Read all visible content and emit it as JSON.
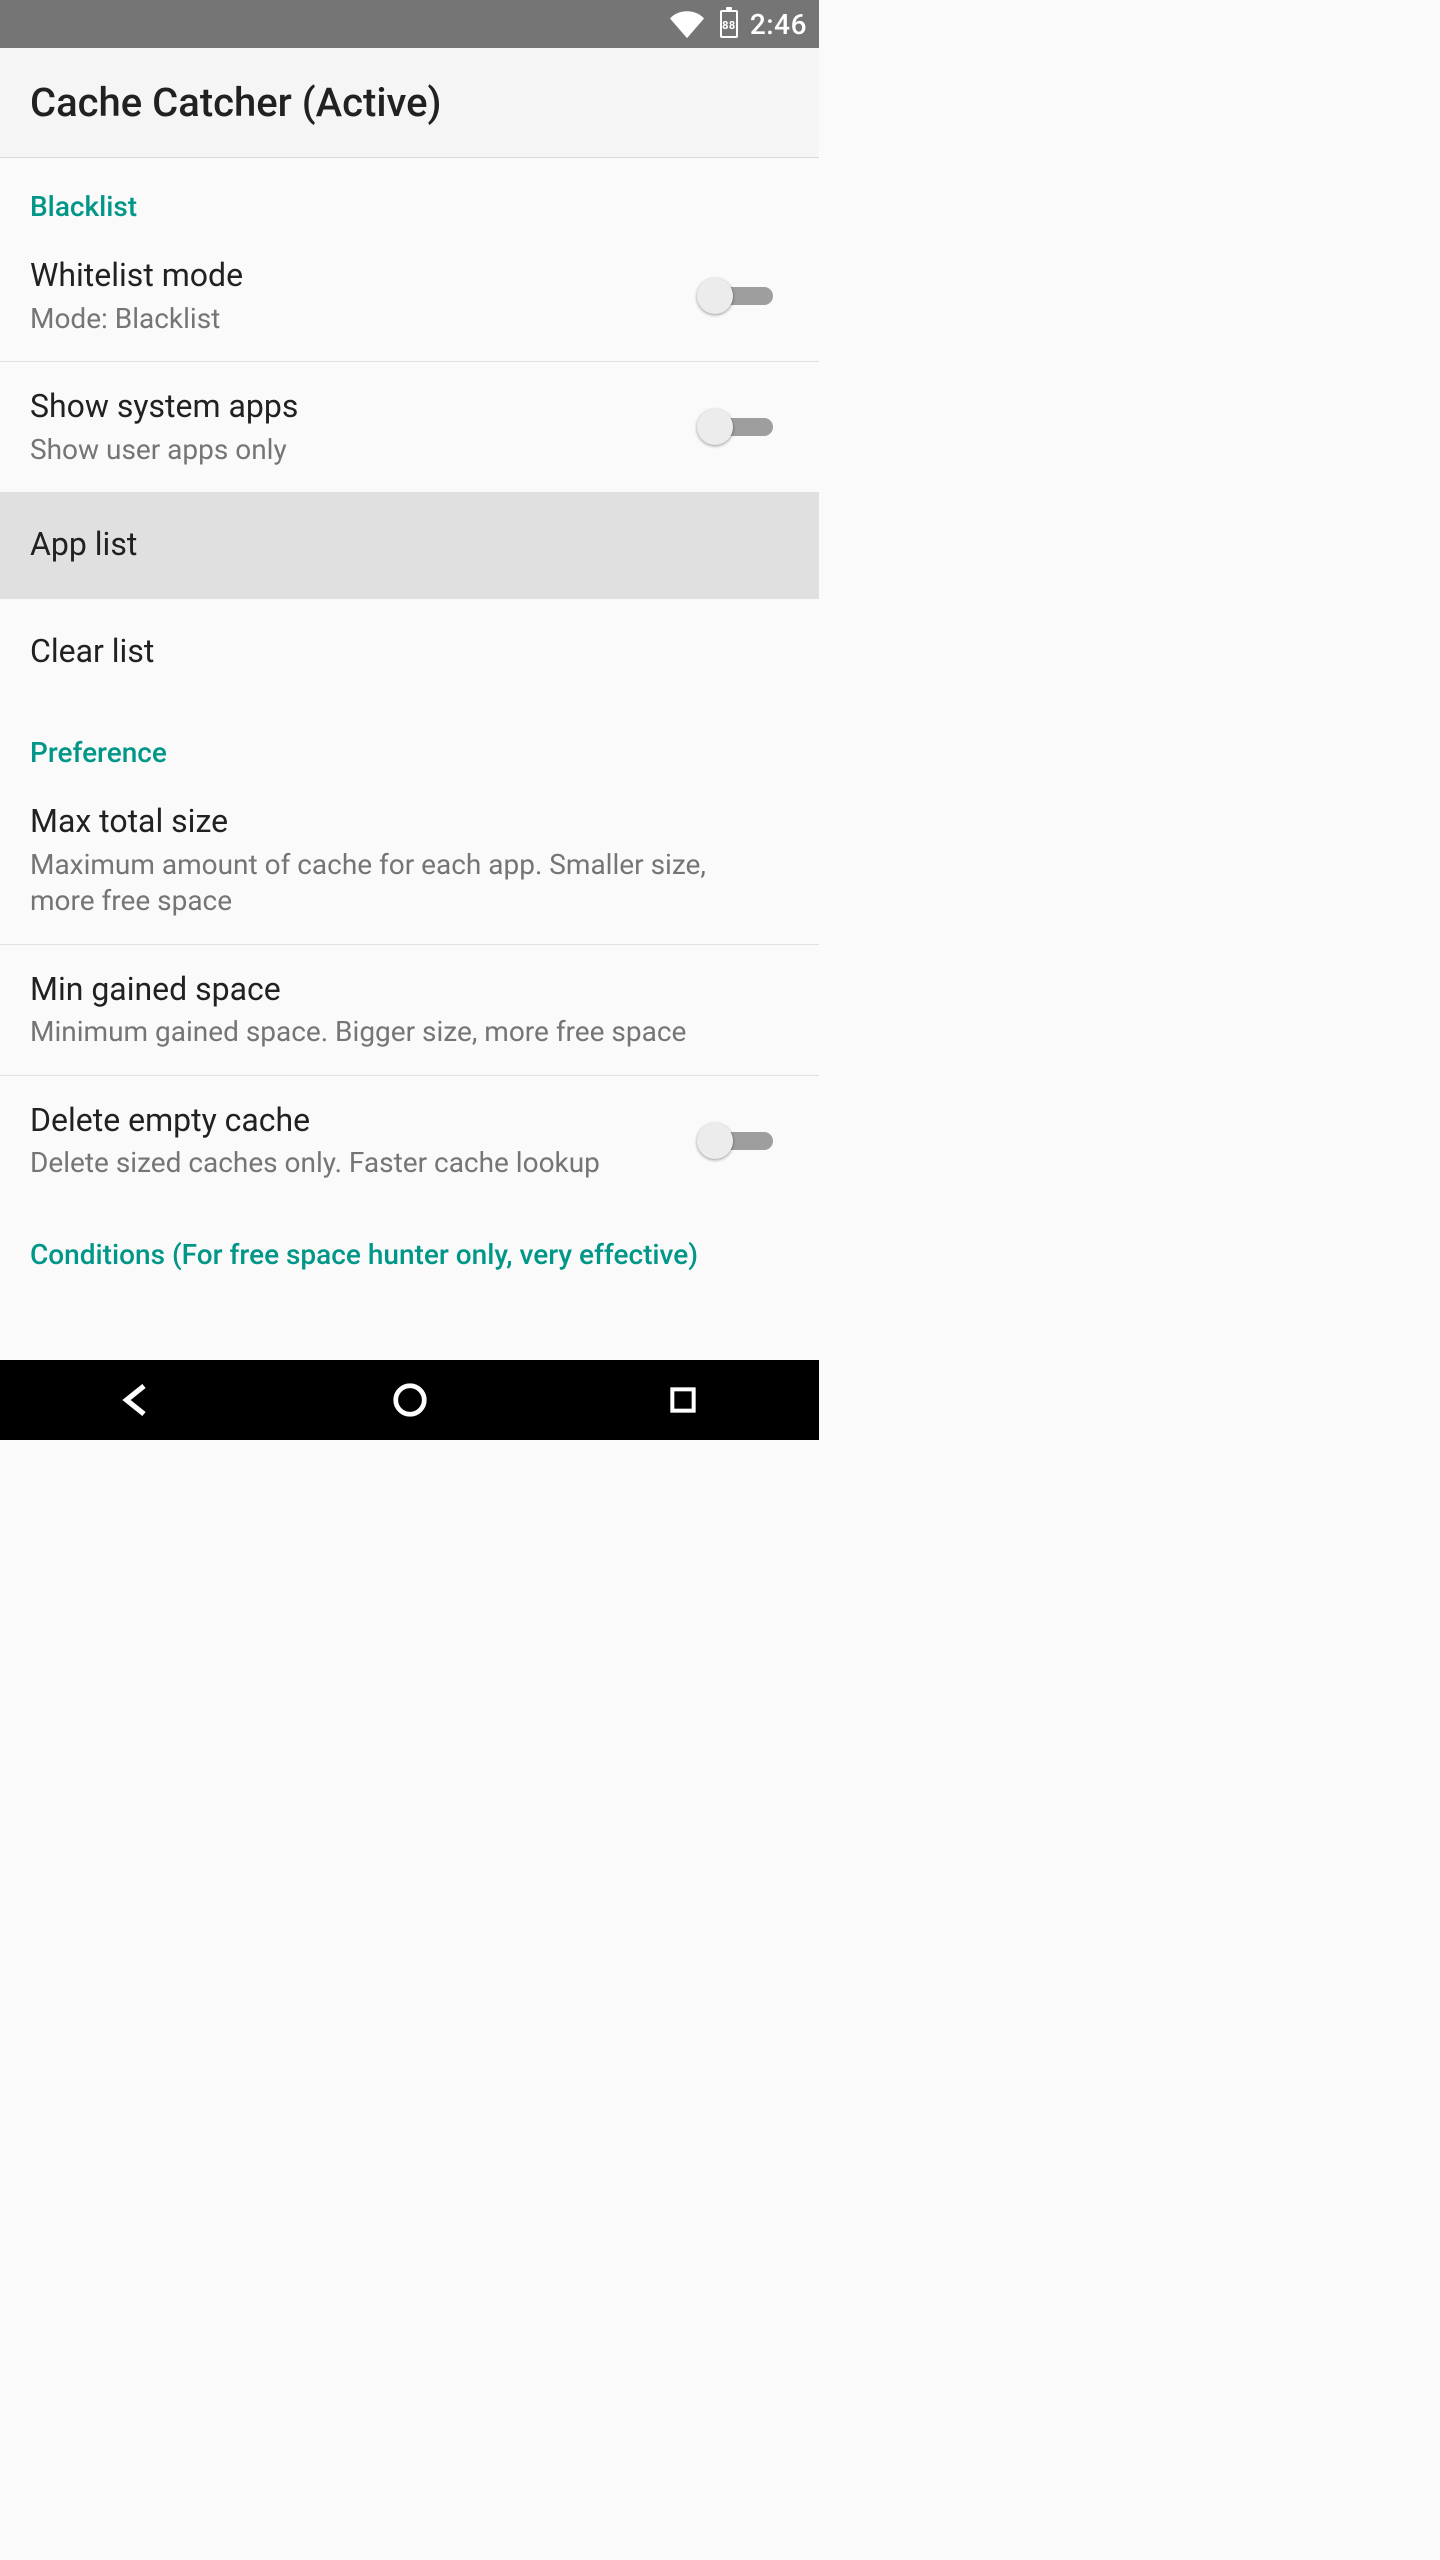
{
  "status": {
    "battery_level": "88",
    "time": "2:46"
  },
  "app_title": "Cache Catcher (Active)",
  "sections": {
    "blacklist": {
      "header": "Blacklist",
      "whitelist_mode": {
        "title": "Whitelist mode",
        "sub": "Mode: Blacklist",
        "on": false
      },
      "show_system_apps": {
        "title": "Show system apps",
        "sub": "Show user apps only",
        "on": false
      },
      "app_list": {
        "title": "App list"
      },
      "clear_list": {
        "title": "Clear list"
      }
    },
    "preference": {
      "header": "Preference",
      "max_total_size": {
        "title": "Max total size",
        "sub": "Maximum amount of cache for each app. Smaller size, more free space"
      },
      "min_gained_space": {
        "title": "Min gained space",
        "sub": "Minimum gained space. Bigger size, more free space"
      },
      "delete_empty_cache": {
        "title": "Delete empty cache",
        "sub": "Delete sized caches only. Faster cache lookup",
        "on": false
      }
    },
    "conditions": {
      "header": "Conditions (For free space hunter only, very effective)"
    }
  },
  "colors": {
    "accent": "#009688",
    "text_primary": "#212121",
    "text_secondary": "#757575"
  }
}
